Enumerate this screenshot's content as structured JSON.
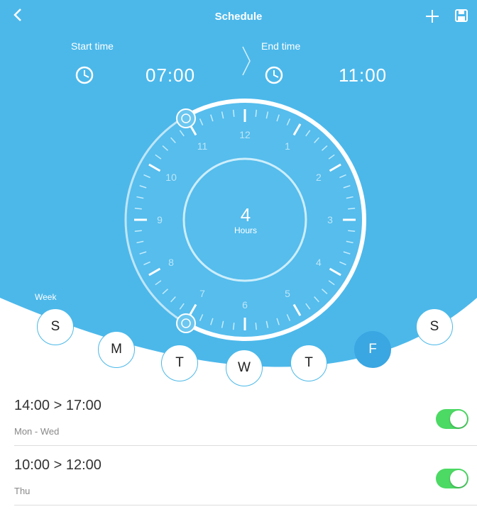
{
  "colors": {
    "primary": "#4cb8ea",
    "selected_day": "#3aa6e2",
    "toggle_on": "#4cd964"
  },
  "header": {
    "title": "Schedule",
    "back_icon": "chevron-left-icon",
    "add_icon": "plus-icon",
    "save_icon": "floppy-disk-icon"
  },
  "time_range": {
    "start_label": "Start time",
    "start_value": "07:00",
    "end_label": "End time",
    "end_value": "11:00",
    "start_icon": "clock-icon",
    "end_icon": "clock-icon",
    "arrow_icon": "chevron-right-icon"
  },
  "dial": {
    "hours_number": "4",
    "hours_label": "Hours",
    "numbers": [
      "12",
      "1",
      "2",
      "3",
      "4",
      "5",
      "6",
      "7",
      "8",
      "9",
      "10",
      "11"
    ],
    "start_handle_icon": "clock-icon",
    "end_handle_icon": "clock-icon"
  },
  "week": {
    "label": "Week",
    "days": [
      {
        "letter": "S",
        "selected": false
      },
      {
        "letter": "M",
        "selected": false
      },
      {
        "letter": "T",
        "selected": false
      },
      {
        "letter": "W",
        "selected": false
      },
      {
        "letter": "T",
        "selected": false
      },
      {
        "letter": "F",
        "selected": true
      },
      {
        "letter": "S",
        "selected": false
      }
    ]
  },
  "schedules": [
    {
      "range": "14:00 > 17:00",
      "days": "Mon - Wed",
      "enabled": true
    },
    {
      "range": "10:00 > 12:00",
      "days": "Thu",
      "enabled": true
    }
  ]
}
